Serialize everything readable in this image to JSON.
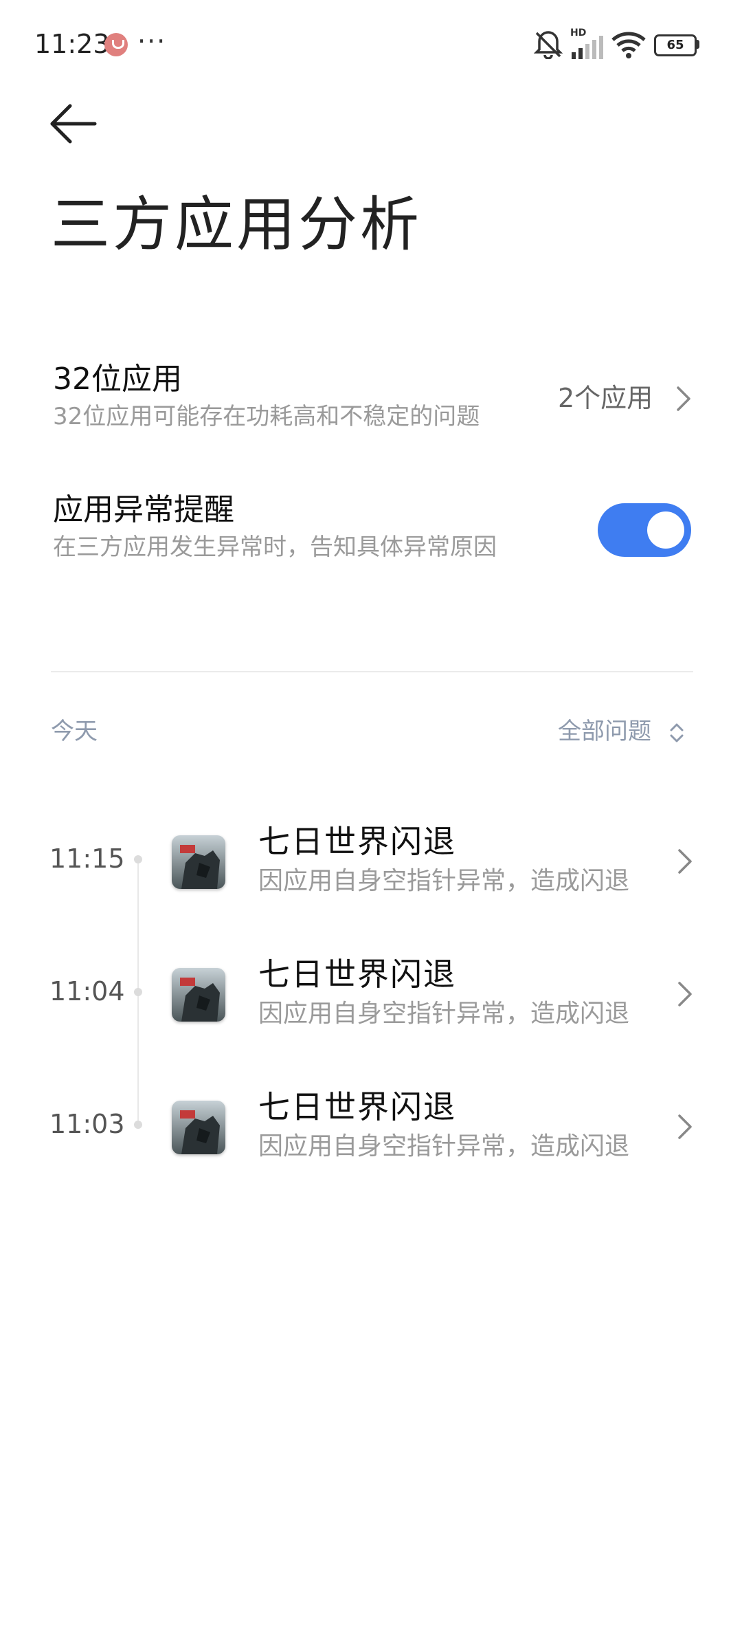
{
  "status_bar": {
    "time": "11:23",
    "more": "···",
    "battery": "65",
    "network_badge": "HD"
  },
  "page": {
    "title": "三方应用分析"
  },
  "settings": {
    "bit32": {
      "title": "32位应用",
      "subtitle": "32位应用可能存在功耗高和不稳定的问题",
      "value": "2个应用"
    },
    "alert": {
      "title": "应用异常提醒",
      "subtitle": "在三方应用发生异常时，告知具体异常原因",
      "enabled": true
    }
  },
  "log": {
    "date": "今天",
    "filter": "全部问题",
    "events": [
      {
        "time": "11:15",
        "title": "七日世界闪退",
        "subtitle": "因应用自身空指针异常，造成闪退"
      },
      {
        "time": "11:04",
        "title": "七日世界闪退",
        "subtitle": "因应用自身空指针异常，造成闪退"
      },
      {
        "time": "11:03",
        "title": "七日世界闪退",
        "subtitle": "因应用自身空指针异常，造成闪退"
      }
    ]
  },
  "colors": {
    "accent": "#3f7df1",
    "secondary_text": "#9a9a9a",
    "section_text": "#8e9aad"
  }
}
